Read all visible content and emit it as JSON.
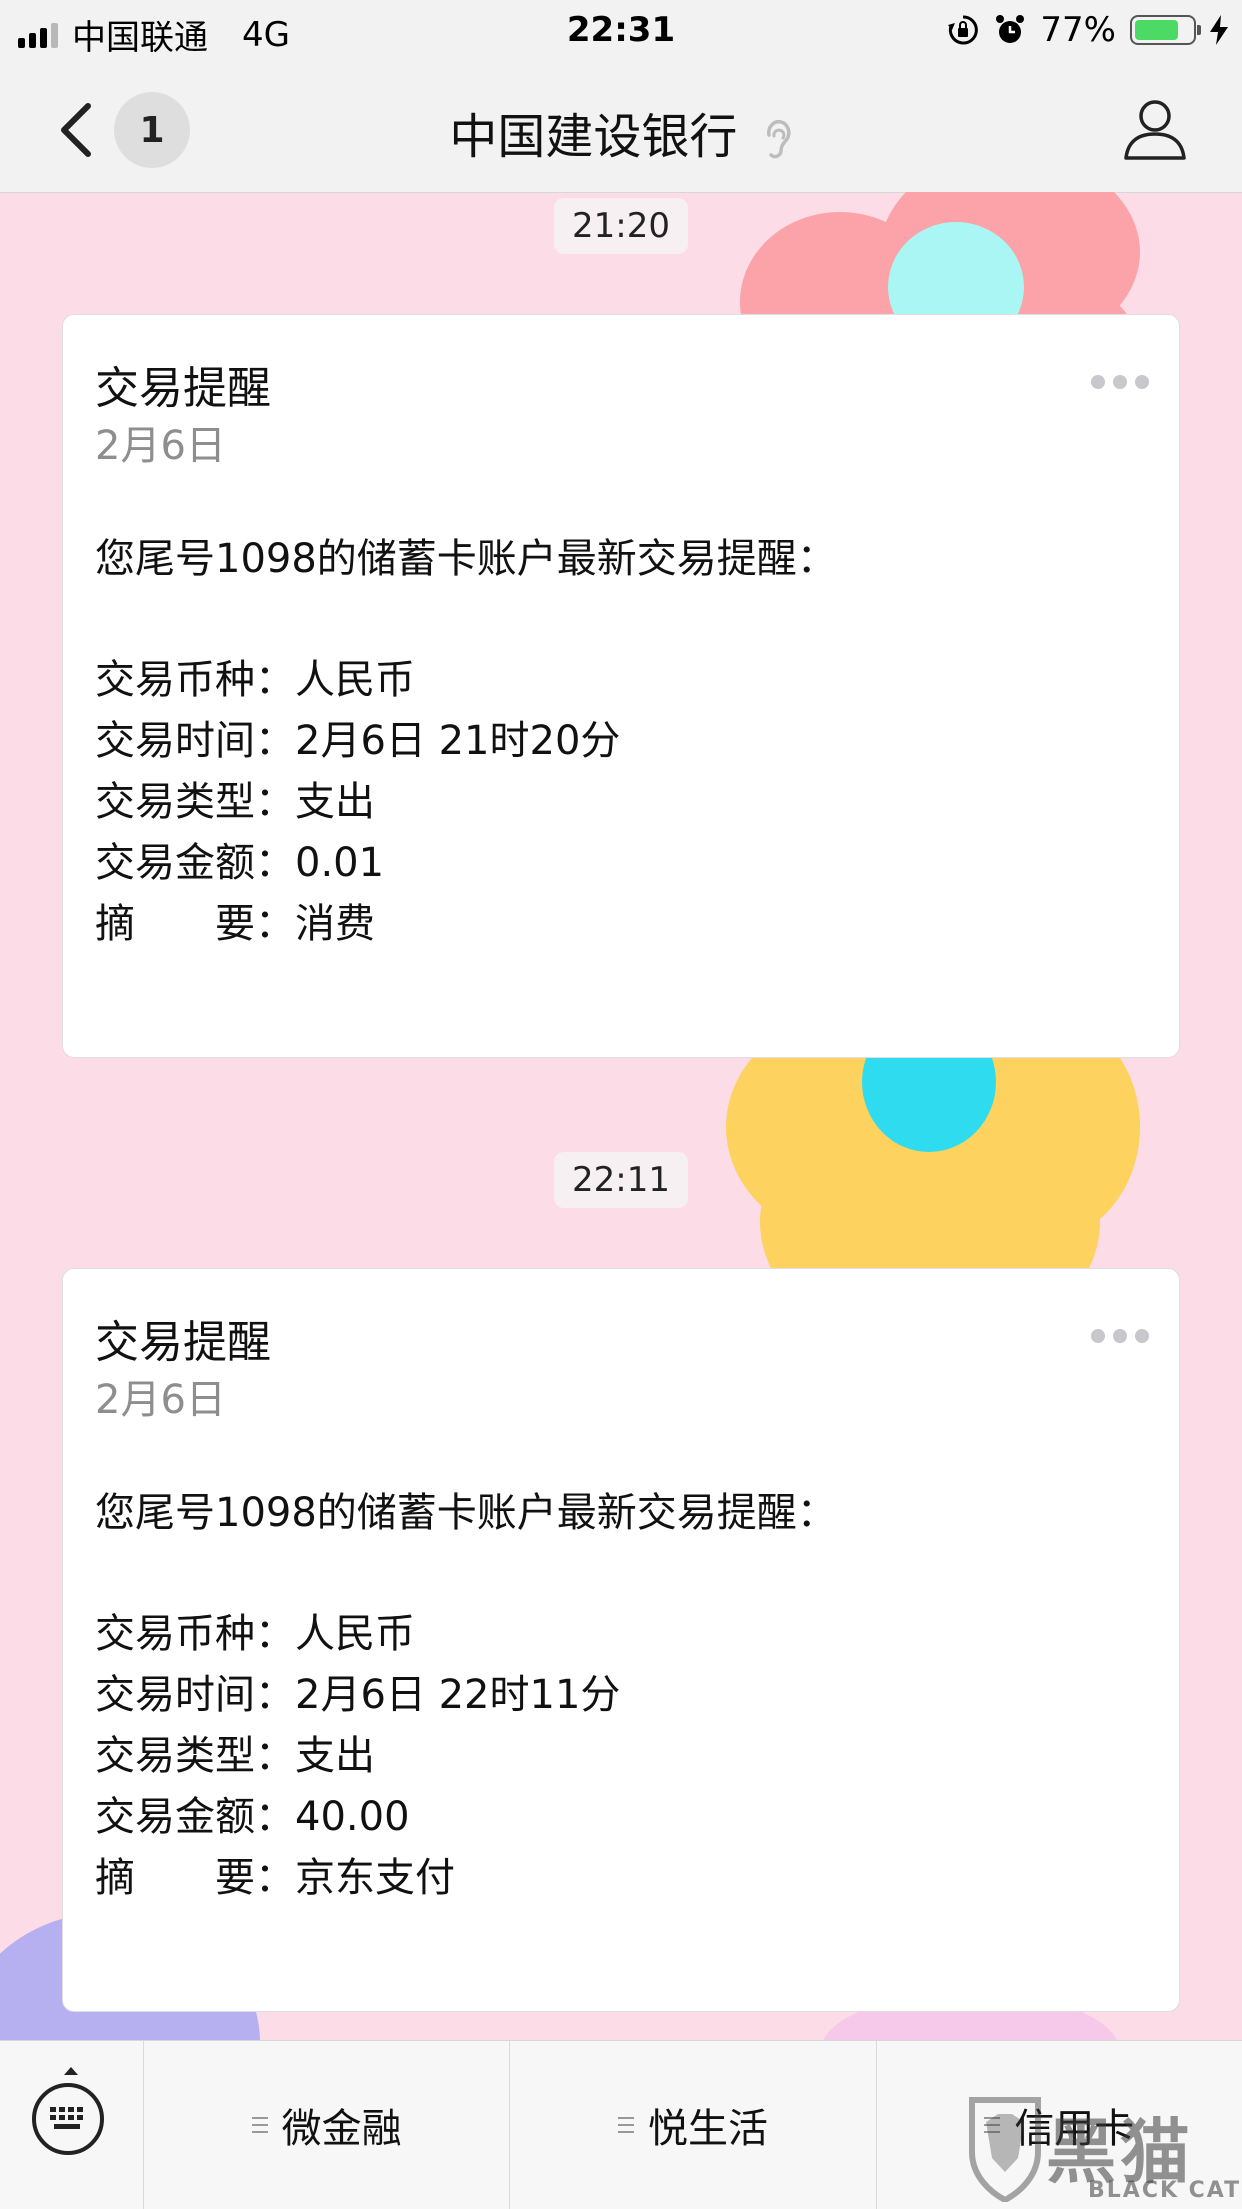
{
  "status_bar": {
    "carrier": "中国联通",
    "network": "4G",
    "time": "22:31",
    "battery_percent": "77%",
    "battery_level": 0.77,
    "signal_bars": 3,
    "icons": [
      "signal-icon",
      "orientation-lock-icon",
      "alarm-icon",
      "battery-icon",
      "charging-bolt-icon"
    ],
    "battery_color": "#4cd964"
  },
  "nav": {
    "back_icon": "chevron-left-icon",
    "unread_count": "1",
    "title": "中国建设银行",
    "title_icon": "ear-icon",
    "profile_icon": "person-icon"
  },
  "messages": [
    {
      "timestamp": "21:20",
      "card": {
        "title": "交易提醒",
        "date": "2月6日",
        "intro": "您尾号1098的储蓄卡账户最新交易提醒：",
        "rows": [
          {
            "label": "交易币种",
            "value": "人民币"
          },
          {
            "label": "交易时间",
            "value": "2月6日 21时20分"
          },
          {
            "label": "交易类型",
            "value": "支出"
          },
          {
            "label": "交易金额",
            "value": "0.01"
          },
          {
            "label_a": "摘",
            "label_b": "要",
            "value": "消费"
          }
        ]
      }
    },
    {
      "timestamp": "22:11",
      "card": {
        "title": "交易提醒",
        "date": "2月6日",
        "intro": "您尾号1098的储蓄卡账户最新交易提醒：",
        "rows": [
          {
            "label": "交易币种",
            "value": "人民币"
          },
          {
            "label": "交易时间",
            "value": "2月6日 22时11分"
          },
          {
            "label": "交易类型",
            "value": "支出"
          },
          {
            "label": "交易金额",
            "value": "40.00"
          },
          {
            "label_a": "摘",
            "label_b": "要",
            "value": "京东支付"
          }
        ]
      }
    }
  ],
  "separator": "：",
  "tab_bar": {
    "keyboard_icon": "keyboard-icon",
    "tabs": [
      {
        "label": "微金融",
        "icon": "menu-icon"
      },
      {
        "label": "悦生活",
        "icon": "menu-icon"
      },
      {
        "label": "信用卡",
        "icon": "menu-icon"
      }
    ]
  },
  "watermark": {
    "text": "黑猫",
    "sub": "BLACK CAT"
  },
  "colors": {
    "chat_background": "#fcdde7",
    "flower_red": "#fba3a8",
    "flower_yellow": "#fdd25e",
    "flower_center_cyan": "#2fdcef",
    "flower_purple": "#b6b0f0"
  }
}
